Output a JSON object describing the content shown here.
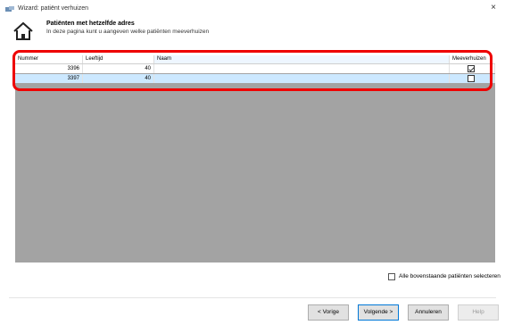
{
  "window": {
    "title": "Wizard: patiënt verhuizen",
    "close_glyph": "×"
  },
  "header": {
    "title": "Patiënten met hetzelfde adres",
    "subtitle": "In deze pagina kunt u aangeven welke patiënten meeverhuizen",
    "icon": "house-icon"
  },
  "grid": {
    "columns": [
      "Nummer",
      "Leeftijd",
      "Naam",
      "Meeverhuizen"
    ],
    "rows": [
      {
        "nummer": "3396",
        "leeftijd": "40",
        "naam": "",
        "meeverhuizen": true
      },
      {
        "nummer": "3397",
        "leeftijd": "40",
        "naam": "",
        "meeverhuizen": false
      }
    ],
    "selected_row_color": "#cce8ff",
    "empty_area_color": "#a3a3a3"
  },
  "select_all": {
    "label": "Alle bovenstaande patiënten selecteren",
    "checked": false
  },
  "buttons": {
    "previous": "< Vorige",
    "next": "Volgende >",
    "cancel": "Annuleren",
    "help": "Help"
  },
  "colors": {
    "highlight": "#ee0000",
    "accent": "#0078d7"
  }
}
